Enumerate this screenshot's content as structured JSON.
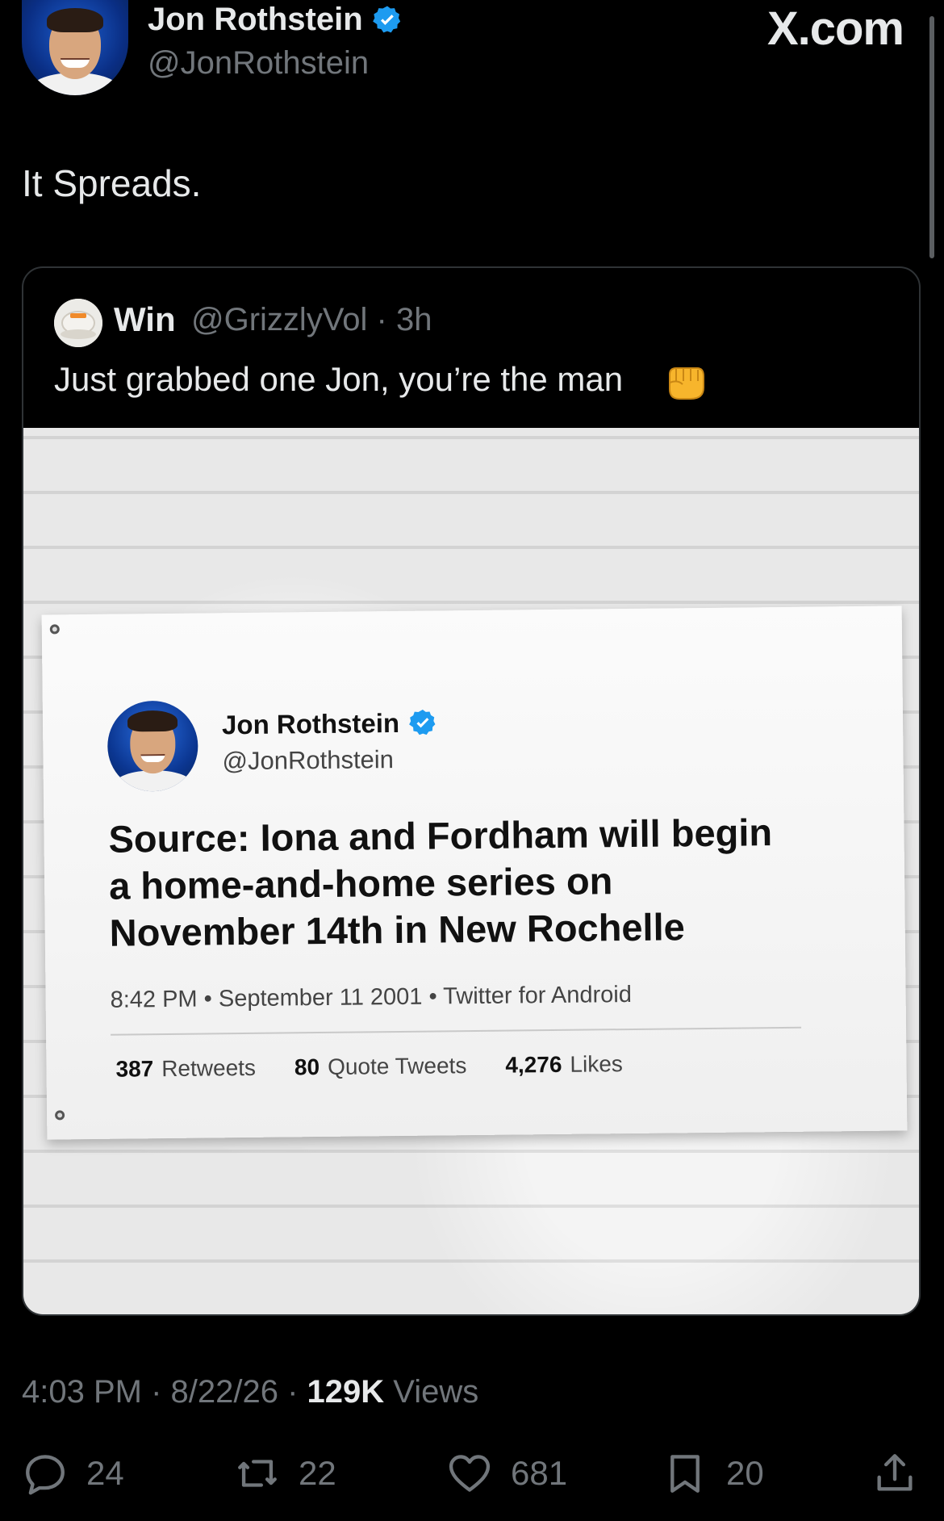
{
  "header": {
    "name": "Jon Rothstein",
    "handle": "@JonRothstein",
    "site": "X.com"
  },
  "tweet": {
    "text": "It Spreads."
  },
  "quote": {
    "name": "Win",
    "meta": "@GrizzlyVol · 3h",
    "text": "Just grabbed one Jon, you’re the man",
    "emoji": "fist-bump-emoji"
  },
  "flag": {
    "name": "Jon Rothstein",
    "handle": "@JonRothstein",
    "text": "Source: Iona and Fordham will begin a home-and-home series on November 14th in New Rochelle",
    "meta": "8:42 PM • September 11 2001 • Twitter for Android",
    "retweets_count": "387",
    "retweets_label": "Retweets",
    "quotes_count": "80",
    "quotes_label": "Quote Tweets",
    "likes_count": "4,276",
    "likes_label": "Likes"
  },
  "footer": {
    "time_date": "4:03 PM · 8/22/26 · ",
    "views_count": "129K",
    "views_label": " Views"
  },
  "actions": {
    "replies": "24",
    "reposts": "22",
    "likes": "681",
    "bookmarks": "20"
  },
  "colors": {
    "background": "#000000",
    "text_primary": "#e7e9ea",
    "text_secondary": "#71767b",
    "verified": "#1d9bf0",
    "border": "#2f3336"
  }
}
